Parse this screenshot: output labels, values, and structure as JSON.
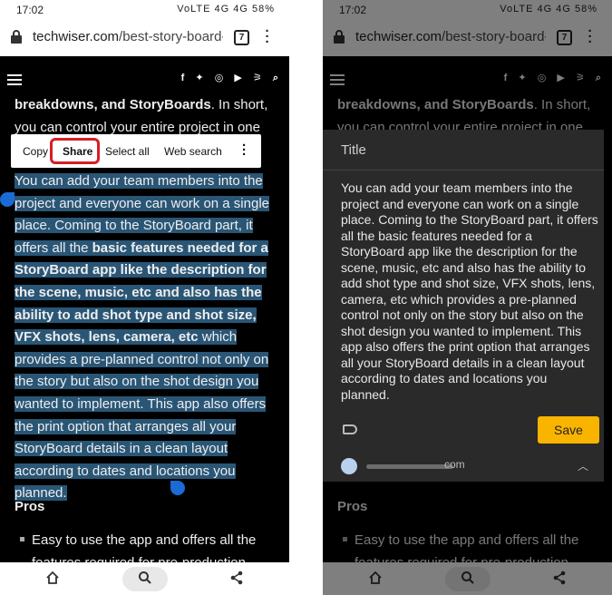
{
  "status": {
    "time": "17:02",
    "battery": "58%",
    "icons": "VoLTE 4G 4G"
  },
  "browser": {
    "url_host": "techwiser.com",
    "url_path": "/best-story-board-",
    "tab_count": "7",
    "menu_icon": "kebab-menu-icon"
  },
  "site_nav": {
    "icons": [
      "f",
      "t",
      "ig",
      "yt",
      "rss",
      "search"
    ]
  },
  "article": {
    "lead_bold": "breakdowns, and StoryBoards",
    "lead_rest": ". In short, you can control your entire project in one",
    "sel_p1": "You can add your team members into the project and everyone can work on a single place. Coming to the StoryBoard part, it offers all the ",
    "sel_bold": "basic features needed for a StoryBoard app like the description for the scene, music, etc and also has the ability to add shot type and shot size, VFX shots, lens, camera, etc",
    "sel_p2": " which provides a pre-planned control not only on the story but also on the shot design you wanted to implement. This app also offers the print option that arranges all your StoryBoard details in a clean layout according to dates and locations you planned.",
    "pros_heading": "Pros",
    "bullet": "Easy to use the app and offers all the features required for pre-production"
  },
  "selection_toolbar": {
    "copy": "Copy",
    "share": "Share",
    "select_all": "Select all",
    "web_search": "Web search",
    "highlight_color": "#d61e24"
  },
  "note_sheet": {
    "title": "Title",
    "body": "You can add your team members into the project and everyone can work on a single place. Coming to the StoryBoard part, it offers all the basic features needed for a StoryBoard app like the description for the scene, music, etc and also has the ability to add shot type and shot size, VFX shots, lens, camera, etc which provides a pre-planned control not only on the story but also on the shot design you wanted to implement. This app also offers the print option that arranges all your StoryBoard details in a clean layout according to dates and locations you planned.",
    "save_label": "Save",
    "account_suffix": "com",
    "save_color": "#f9b400"
  },
  "bottom_nav": {
    "icons": [
      "home-icon",
      "search-icon",
      "share-icon"
    ]
  }
}
